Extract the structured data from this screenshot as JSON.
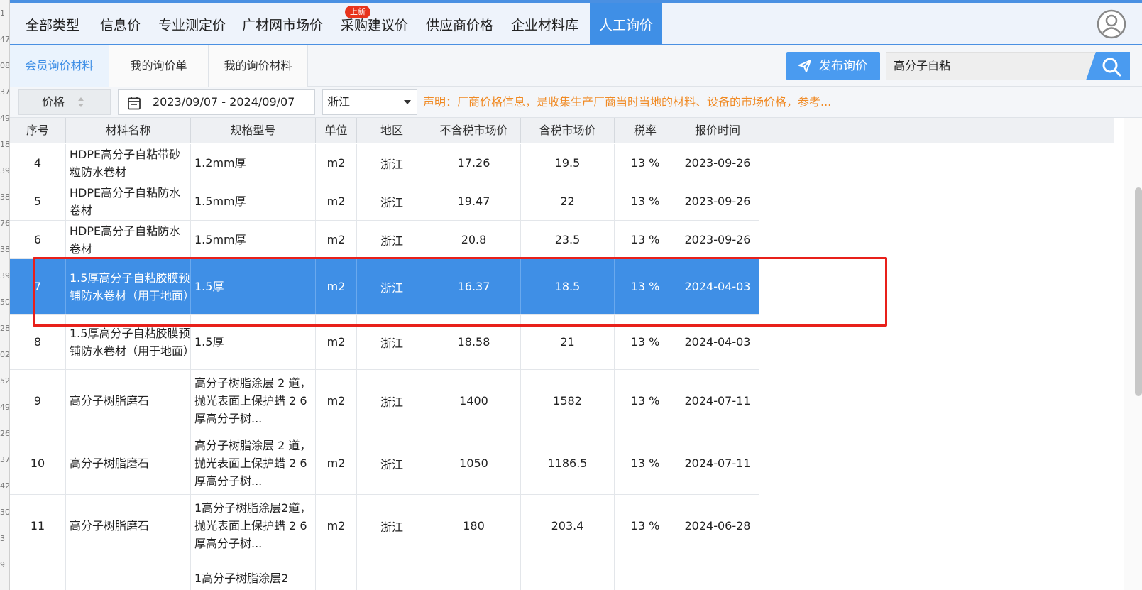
{
  "left_strip": [
    "1",
    "47",
    "08",
    "37",
    "49",
    "18",
    "39",
    "38",
    "76",
    "38",
    "39",
    "50",
    "28",
    "02",
    "52",
    "49",
    "26",
    "37",
    "42",
    "30",
    "3",
    "9"
  ],
  "nav": {
    "tabs": [
      "全部类型",
      "信息价",
      "专业测定价",
      "广材网市场价",
      "采购建议价",
      "供应商价格",
      "企业材料库",
      "人工询价"
    ],
    "new_badge": "上新",
    "active_index": 7
  },
  "subtabs": [
    "会员询价材料",
    "我的询价单",
    "我的询价材料"
  ],
  "publish_label": "发布询价",
  "search": {
    "value": "高分子自粘"
  },
  "filters": {
    "price_label": "价格",
    "date_range": "2023/09/07 - 2024/09/07",
    "region": "浙江",
    "notice": "声明：厂商价格信息，是收集生产厂商当时当地的材料、设备的市场价格，参考..."
  },
  "table": {
    "headers": [
      "序号",
      "材料名称",
      "规格型号",
      "单位",
      "地区",
      "不含税市场价",
      "含税市场价",
      "税率",
      "报价时间"
    ],
    "rows": [
      {
        "no": "4",
        "name": "HDPE高分子自粘带砂粒防水卷材",
        "spec": "1.2mm厚",
        "unit": "m2",
        "region": "浙江",
        "price_ex": "17.26",
        "price_in": "19.5",
        "tax": "13 %",
        "date": "2023-09-26",
        "selected": false
      },
      {
        "no": "5",
        "name": "HDPE高分子自粘防水卷材",
        "spec": "1.5mm厚",
        "unit": "m2",
        "region": "浙江",
        "price_ex": "19.47",
        "price_in": "22",
        "tax": "13 %",
        "date": "2023-09-26",
        "selected": false
      },
      {
        "no": "6",
        "name": "HDPE高分子自粘防水卷材",
        "spec": "1.5mm厚",
        "unit": "m2",
        "region": "浙江",
        "price_ex": "20.8",
        "price_in": "23.5",
        "tax": "13 %",
        "date": "2023-09-26",
        "selected": false
      },
      {
        "no": "7",
        "name": "1.5厚高分子自粘胶膜预铺防水卷材（用于地面）",
        "spec": "1.5厚",
        "unit": "m2",
        "region": "浙江",
        "price_ex": "16.37",
        "price_in": "18.5",
        "tax": "13 %",
        "date": "2024-04-03",
        "selected": true
      },
      {
        "no": "8",
        "name": "1.5厚高分子自粘胶膜预铺防水卷材（用于地面）",
        "spec": "1.5厚",
        "unit": "m2",
        "region": "浙江",
        "price_ex": "18.58",
        "price_in": "21",
        "tax": "13 %",
        "date": "2024-04-03",
        "selected": false
      },
      {
        "no": "9",
        "name": "高分子树脂磨石",
        "spec": "高分子树脂涂层 2 道，抛光表面上保护蜡 2 6 厚高分子树...",
        "unit": "m2",
        "region": "浙江",
        "price_ex": "1400",
        "price_in": "1582",
        "tax": "13 %",
        "date": "2024-07-11",
        "selected": false
      },
      {
        "no": "10",
        "name": "高分子树脂磨石",
        "spec": "高分子树脂涂层 2 道，抛光表面上保护蜡 2 6 厚高分子树...",
        "unit": "m2",
        "region": "浙江",
        "price_ex": "1050",
        "price_in": "1186.5",
        "tax": "13 %",
        "date": "2024-07-11",
        "selected": false
      },
      {
        "no": "11",
        "name": "高分子树脂磨石",
        "spec": "1高分子树脂涂层2道，抛光表面上保护蜡 2 6厚高分子树...",
        "unit": "m2",
        "region": "浙江",
        "price_ex": "180",
        "price_in": "203.4",
        "tax": "13 %",
        "date": "2024-06-28",
        "selected": false
      },
      {
        "no": "",
        "name": "",
        "spec": "1高分子树脂涂层2",
        "unit": "",
        "region": "",
        "price_ex": "",
        "price_in": "",
        "tax": "",
        "date": "",
        "selected": false
      }
    ]
  },
  "colors": {
    "accent": "#3f8fe6",
    "notice": "#f08a24",
    "highlight": "#e8201a",
    "badge": "#e8341c"
  }
}
